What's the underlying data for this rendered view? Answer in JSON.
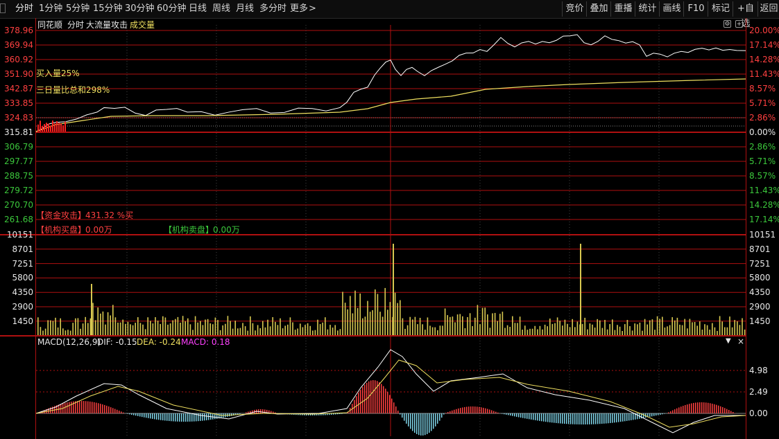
{
  "toolbar": {
    "periods": [
      "分时",
      "1分钟",
      "5分钟",
      "15分钟",
      "30分钟",
      "60分钟",
      "日线",
      "周线",
      "月线",
      "多分时",
      "更多"
    ],
    "more_arrow": ">",
    "actions": [
      "竞价",
      "叠加",
      "重播",
      "统计",
      "画线",
      "F10",
      "标记",
      "+自选",
      "返回"
    ]
  },
  "header": {
    "source": "同花顺",
    "view": "分时",
    "indicator": "大流量攻击",
    "volume_label": "成交量"
  },
  "price_panel": {
    "left_ticks": [
      "378.96",
      "369.94",
      "360.92",
      "351.90",
      "342.87",
      "333.85",
      "324.83",
      "315.81",
      "306.79",
      "297.77",
      "288.75",
      "279.72",
      "270.70",
      "261.68"
    ],
    "right_ticks": [
      "20.00%",
      "17.14%",
      "14.28%",
      "11.43%",
      "8.57%",
      "5.71%",
      "2.86%",
      "0.00%",
      "2.86%",
      "5.71%",
      "8.57%",
      "11.43%",
      "14.28%",
      "17.14%"
    ],
    "buy_ratio": "买入量25%",
    "three_day_ratio": "三日量比总和298%",
    "fund_attack_label": "【资金攻击】",
    "fund_attack_value": "431.32 %买",
    "inst_buy_label": "【机构买盘】",
    "inst_buy_value": "0.00万",
    "inst_sell_label": "【机构卖盘】",
    "inst_sell_value": "0.00万"
  },
  "volume_panel": {
    "left_ticks": [
      "10151",
      "8701",
      "7251",
      "5800",
      "4350",
      "2900",
      "1450"
    ],
    "right_ticks": [
      "10151",
      "8701",
      "7251",
      "5800",
      "4350",
      "2900",
      "1450"
    ]
  },
  "macd_panel": {
    "title": "MACD(12,26,9)",
    "dif_label": "DIF: -0.15",
    "dea_label": "DEA: -0.24",
    "macd_label": "MACD: 0.18",
    "right_ticks": [
      "4.98",
      "2.49",
      "0.00"
    ]
  },
  "colors": {
    "grid_red": "#b01010",
    "price_line": "#ffffff",
    "avg_line": "#f0e060",
    "up_bar": "#ff4040",
    "down_bar": "#7fd4e8",
    "volume_bar": "#d8c850"
  }
}
